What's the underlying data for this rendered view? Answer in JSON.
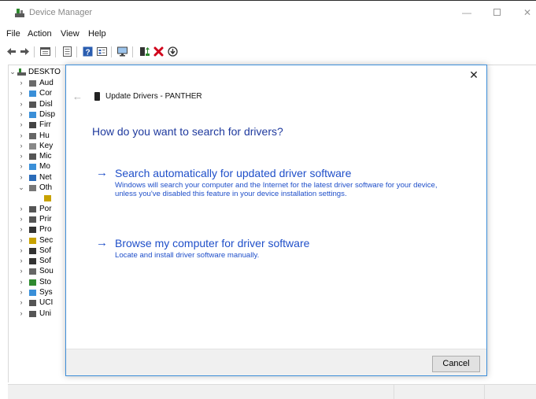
{
  "window": {
    "title": "Device Manager",
    "controls": {
      "minimize": "—",
      "maximize": "",
      "close": "✕"
    }
  },
  "menu": [
    "File",
    "Action",
    "View",
    "Help"
  ],
  "toolbar": {
    "icons": [
      "back-arrow-icon",
      "forward-arrow-icon",
      "properties-icon",
      "details-icon",
      "help-icon",
      "view-icon",
      "monitor-icon",
      "update-driver-icon",
      "uninstall-icon",
      "enable-icon"
    ],
    "uninstall_color": "#d0021b",
    "update_color": "#2f8a2f"
  },
  "tree": {
    "root_label": "DESKTO",
    "items": [
      {
        "label": "Aud",
        "icon": "speaker-icon",
        "expanded": false
      },
      {
        "label": "Cor",
        "icon": "computer-icon",
        "expanded": false
      },
      {
        "label": "Disl",
        "icon": "disk-icon",
        "expanded": false
      },
      {
        "label": "Disp",
        "icon": "display-icon",
        "expanded": false
      },
      {
        "label": "Firr",
        "icon": "firmware-icon",
        "expanded": false
      },
      {
        "label": "Hu",
        "icon": "hid-icon",
        "expanded": false
      },
      {
        "label": "Key",
        "icon": "keyboard-icon",
        "expanded": false
      },
      {
        "label": "Mic",
        "icon": "mouse-icon",
        "expanded": false
      },
      {
        "label": "Mo",
        "icon": "monitor-icon",
        "expanded": false
      },
      {
        "label": "Net",
        "icon": "network-icon",
        "expanded": false
      },
      {
        "label": "Oth",
        "icon": "other-devices-icon",
        "expanded": true
      },
      {
        "label": "",
        "icon": "unknown-device-icon",
        "expanded": null
      },
      {
        "label": "Por",
        "icon": "port-icon",
        "expanded": false
      },
      {
        "label": "Prir",
        "icon": "printer-icon",
        "expanded": false
      },
      {
        "label": "Pro",
        "icon": "processor-icon",
        "expanded": false
      },
      {
        "label": "Sec",
        "icon": "security-icon",
        "expanded": false
      },
      {
        "label": "Sof",
        "icon": "software-component-icon",
        "expanded": false
      },
      {
        "label": "Sof",
        "icon": "software-device-icon",
        "expanded": false
      },
      {
        "label": "Sou",
        "icon": "sound-icon",
        "expanded": false
      },
      {
        "label": "Sto",
        "icon": "storage-icon",
        "expanded": false
      },
      {
        "label": "Sys",
        "icon": "system-icon",
        "expanded": false
      },
      {
        "label": "UCI",
        "icon": "ucm-icon",
        "expanded": false
      },
      {
        "label": "Uni",
        "icon": "usb-icon",
        "expanded": false
      }
    ]
  },
  "dialog": {
    "title": "Update Drivers - PANTHER",
    "heading": "How do you want to search for drivers?",
    "option_auto": {
      "title": "Search automatically for updated driver software",
      "description": "Windows will search your computer and the Internet for the latest driver software for your device, unless you've disabled this feature in your device installation settings."
    },
    "option_browse": {
      "title": "Browse my computer for driver software",
      "description": "Locate and install driver software manually."
    },
    "cancel_label": "Cancel",
    "close_glyph": "✕",
    "back_glyph": "←",
    "arrow_glyph": "→"
  },
  "colors": {
    "link_blue": "#1f4fc9",
    "heading_blue": "#1f3a9e",
    "dialog_border": "#3d8ed9"
  }
}
